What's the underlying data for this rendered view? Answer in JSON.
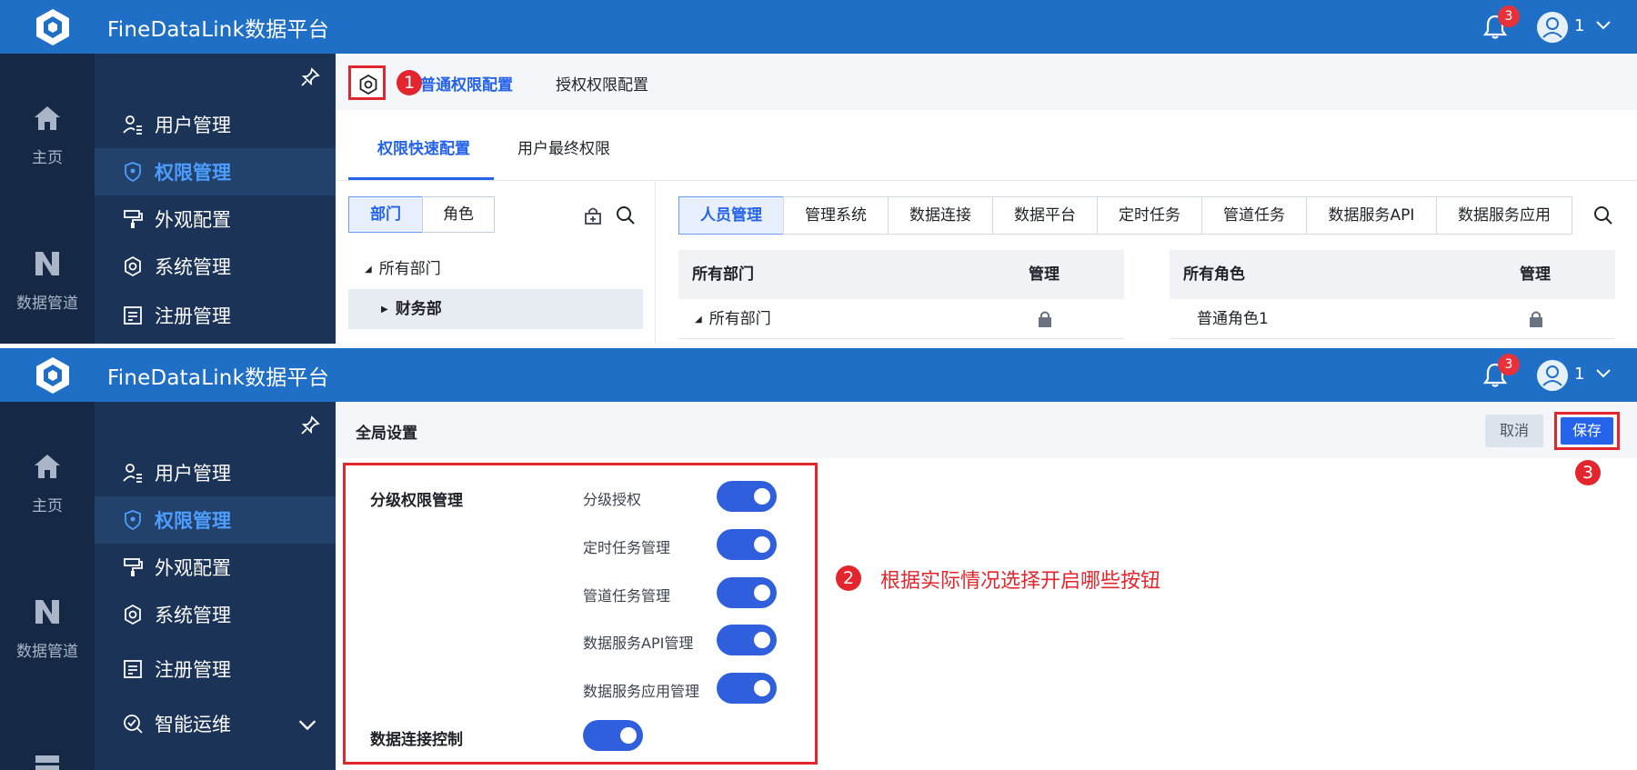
{
  "app": {
    "title": "FineDataLink数据平台",
    "notification_count": "3",
    "user_name": "1"
  },
  "rail": {
    "items": [
      {
        "label": "主页",
        "icon": "home-icon"
      },
      {
        "label": "数据管道",
        "icon": "pipeline-icon"
      }
    ]
  },
  "sidebar": {
    "items": [
      {
        "label": "用户管理",
        "icon": "user-list-icon"
      },
      {
        "label": "权限管理",
        "icon": "shield-icon",
        "active": true
      },
      {
        "label": "外观配置",
        "icon": "paint-icon"
      },
      {
        "label": "系统管理",
        "icon": "gear-icon"
      },
      {
        "label": "注册管理",
        "icon": "register-icon"
      },
      {
        "label": "智能运维",
        "icon": "ops-icon"
      }
    ],
    "top_partial_label": "注册管理"
  },
  "panel1": {
    "markers": {
      "one": "1"
    },
    "top_tabs": [
      "普通权限配置",
      "授权权限配置"
    ],
    "sub_tabs": [
      "权限快速配置",
      "用户最终权限"
    ],
    "segments": [
      "部门",
      "角色"
    ],
    "tree": [
      "所有部门",
      "财务部"
    ],
    "module_tabs": [
      "人员管理",
      "管理系统",
      "数据连接",
      "数据平台",
      "定时任务",
      "管道任务",
      "数据服务API",
      "数据服务应用"
    ],
    "dept_grid": {
      "col1": "所有部门",
      "col2": "管理",
      "row": "所有部门"
    },
    "role_grid": {
      "col1": "所有角色",
      "col2": "管理",
      "row": "普通角色1"
    }
  },
  "panel2": {
    "header_title": "全局设置",
    "cancel_label": "取消",
    "save_label": "保存",
    "markers": {
      "two": "2",
      "three": "3"
    },
    "section1": "分级权限管理",
    "options": [
      "分级授权",
      "定时任务管理",
      "管道任务管理",
      "数据服务API管理",
      "数据服务应用管理"
    ],
    "section2": "数据连接控制",
    "note": "根据实际情况选择开启哪些按钮"
  },
  "colors": {
    "topbar": "#1f6fc6",
    "rail": "#152845",
    "sidebar": "#1b3356",
    "accent": "#2563eb",
    "annotation": "#e3262d"
  }
}
